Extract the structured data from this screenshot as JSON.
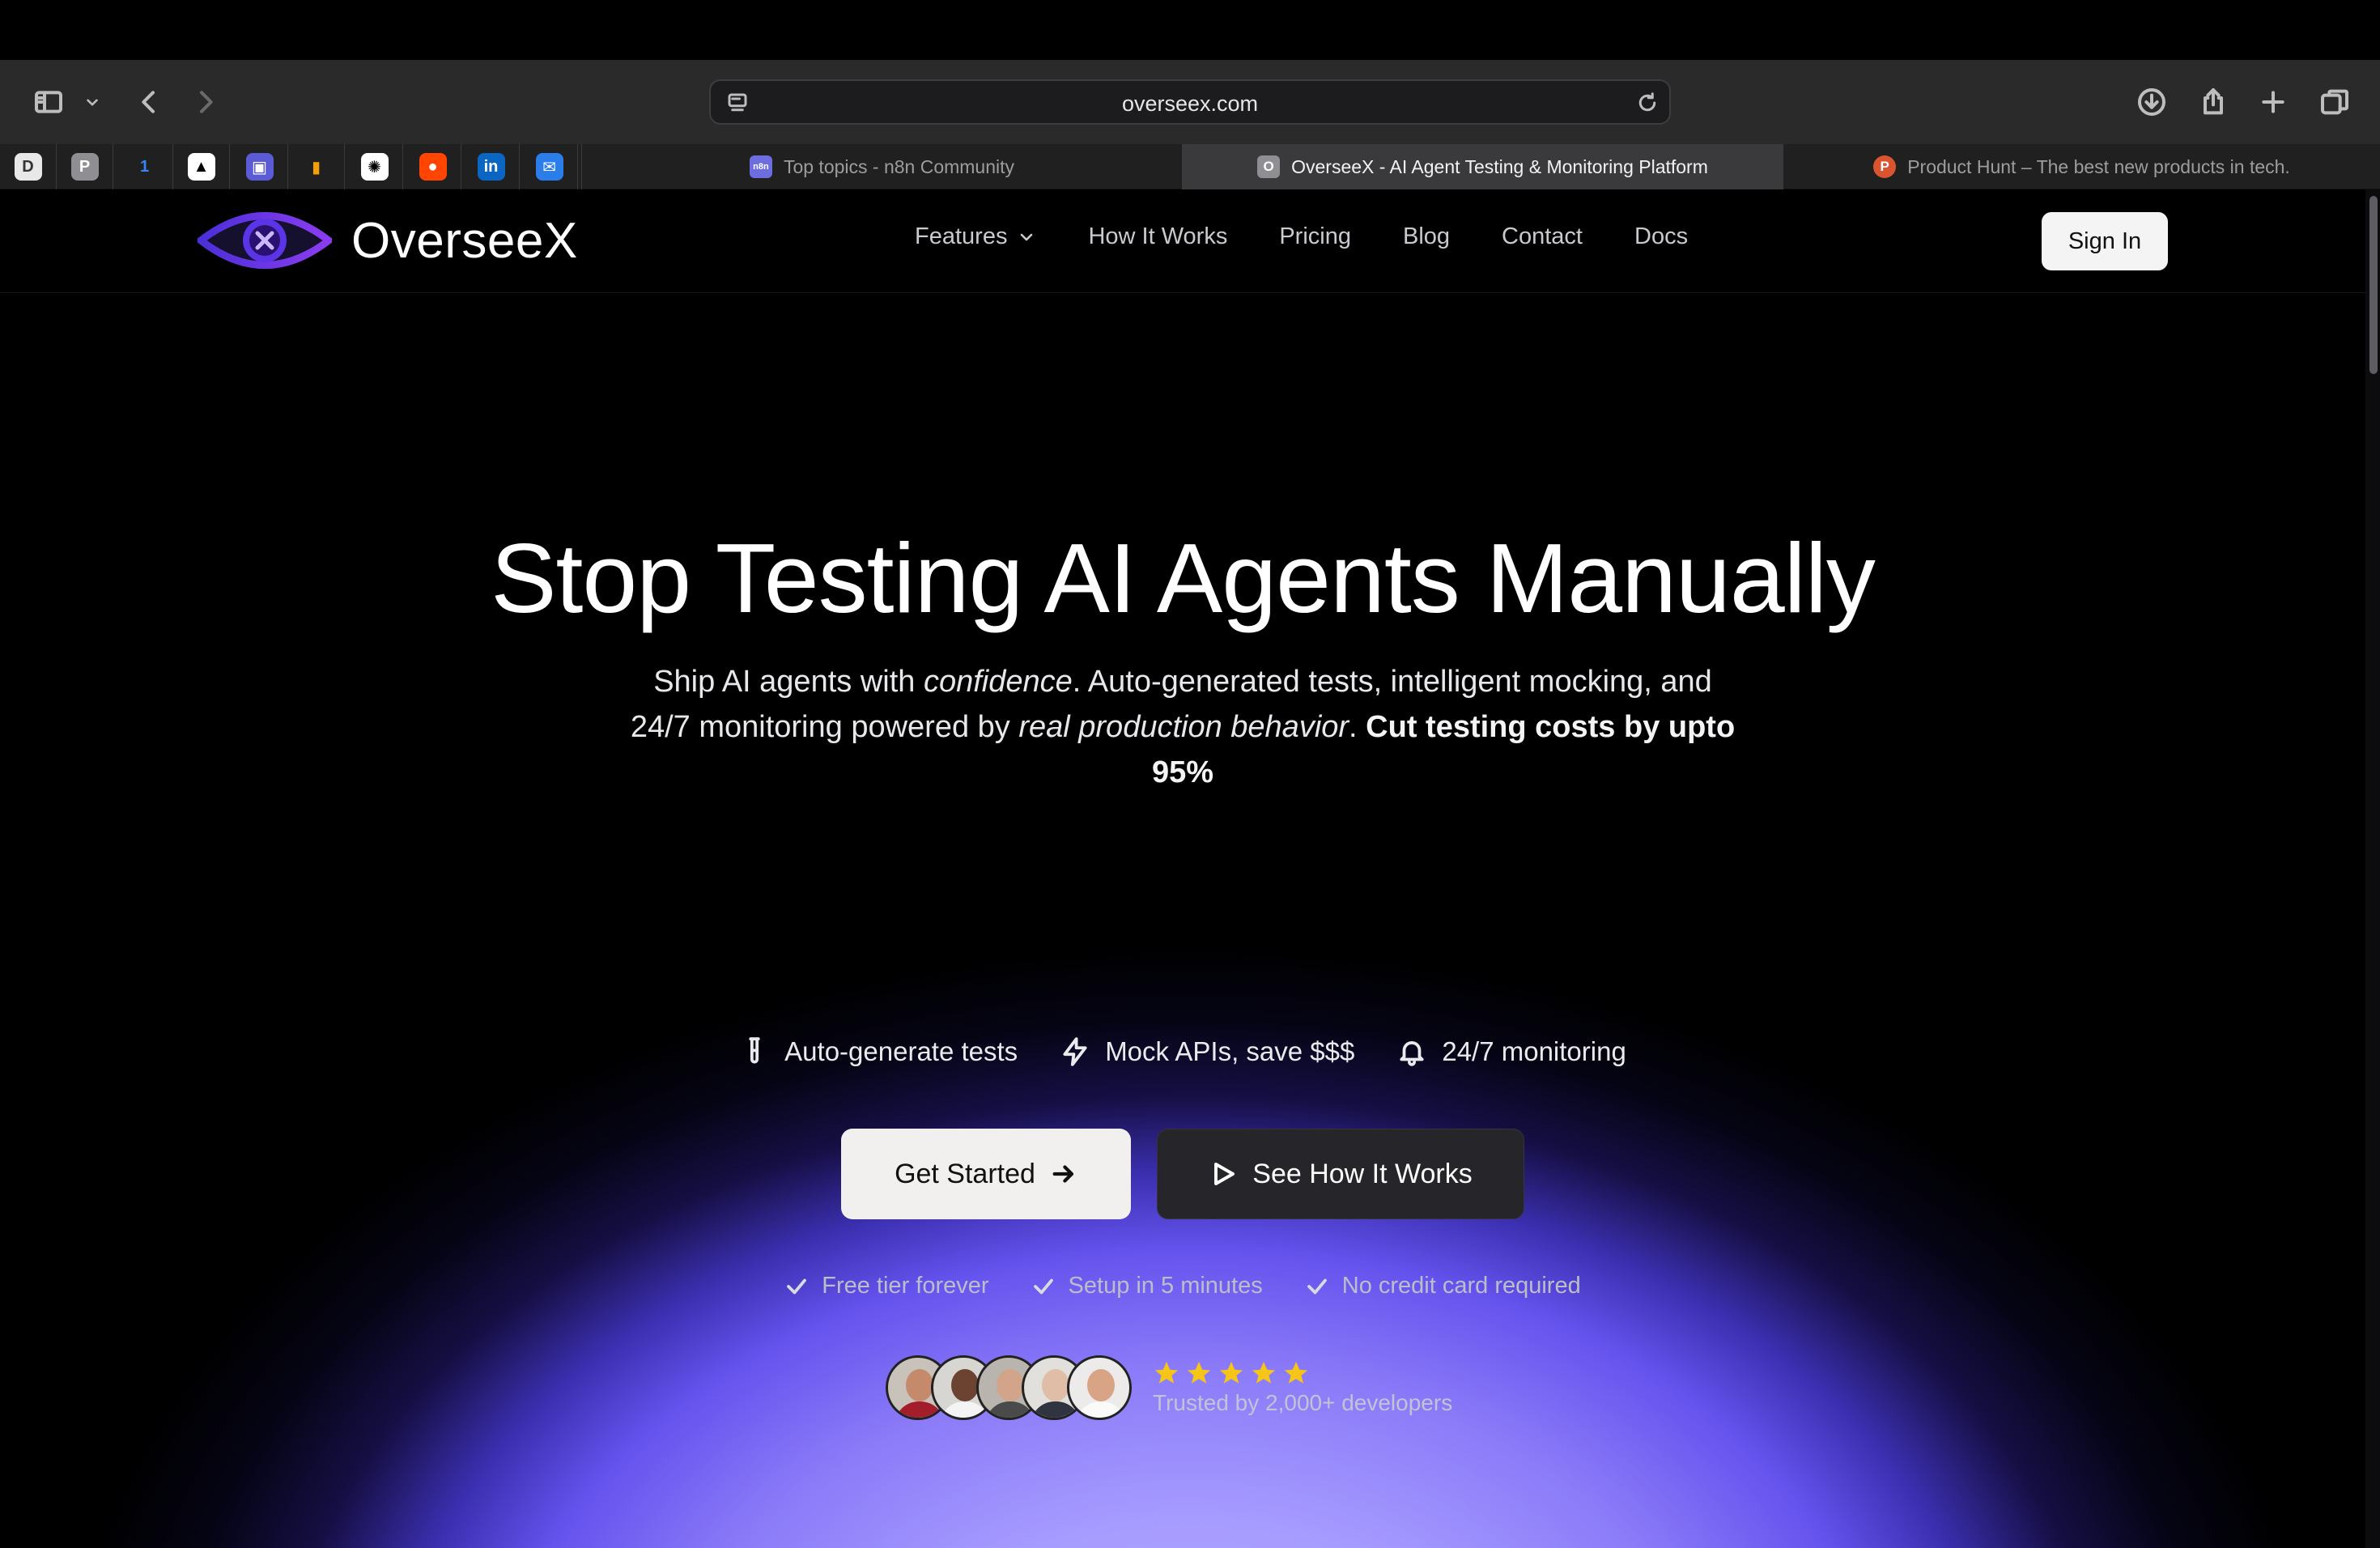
{
  "browser": {
    "url": "overseex.com",
    "pinned_tabs": [
      {
        "icon": "d-app-icon",
        "letter": "D",
        "bg": "#e8e8e8",
        "fg": "#333"
      },
      {
        "icon": "p-app-icon",
        "letter": "P",
        "bg": "#8e8e93",
        "fg": "#fff"
      },
      {
        "icon": "1password-icon",
        "letter": "1",
        "bg": "transparent",
        "fg": "#3b82f6"
      },
      {
        "icon": "vercel-icon",
        "letter": "▲",
        "bg": "#fff",
        "fg": "#000"
      },
      {
        "icon": "save-icon",
        "letter": "▣",
        "bg": "#5b5bd6",
        "fg": "#fff"
      },
      {
        "icon": "analytics-icon",
        "letter": "▮",
        "bg": "transparent",
        "fg": "#f59e0b"
      },
      {
        "icon": "openai-icon",
        "letter": "✺",
        "bg": "#fff",
        "fg": "#000"
      },
      {
        "icon": "reddit-icon",
        "letter": "●",
        "bg": "#ff4500",
        "fg": "#fff"
      },
      {
        "icon": "linkedin-icon",
        "letter": "in",
        "bg": "#0a66c2",
        "fg": "#fff"
      },
      {
        "icon": "outlook-icon",
        "letter": "✉",
        "bg": "#2b7de9",
        "fg": "#fff"
      }
    ],
    "tabs": [
      {
        "label": "Top topics - n8n Community",
        "fav_letter": "n8n",
        "fav_bg": "#6d6de0"
      },
      {
        "label": "OverseeX - AI Agent Testing & Monitoring Platform",
        "fav_letter": "O",
        "fav_bg": "#8e8e93"
      },
      {
        "label": "Product Hunt – The best new products in tech.",
        "fav_letter": "P",
        "fav_bg": "#da552f"
      }
    ]
  },
  "nav": {
    "brand": "OverseeX",
    "links": [
      "Features",
      "How It Works",
      "Pricing",
      "Blog",
      "Contact",
      "Docs"
    ],
    "sign_in": "Sign In"
  },
  "hero": {
    "title": "Stop Testing AI Agents Manually",
    "subtitle": {
      "p1": "Ship AI agents with ",
      "em1": "confidence",
      "p2": ". Auto-generated tests, intelligent mocking, and 24/7 monitoring powered by ",
      "em2": "real production behavior",
      "p3": ". ",
      "strong": "Cut testing costs by upto 95%"
    },
    "features": [
      {
        "icon": "test-tube-icon",
        "label": "Auto-generate tests"
      },
      {
        "icon": "lightning-icon",
        "label": "Mock APIs, save $$$"
      },
      {
        "icon": "bell-icon",
        "label": "24/7 monitoring"
      }
    ],
    "cta_primary": "Get Started",
    "cta_secondary": "See How It Works",
    "checks": [
      "Free tier forever",
      "Setup in 5 minutes",
      "No credit card required"
    ],
    "rating": 5,
    "trust": "Trusted by 2,000+ developers"
  },
  "colors": {
    "accent": "#6553ee",
    "star": "#f5c518"
  }
}
